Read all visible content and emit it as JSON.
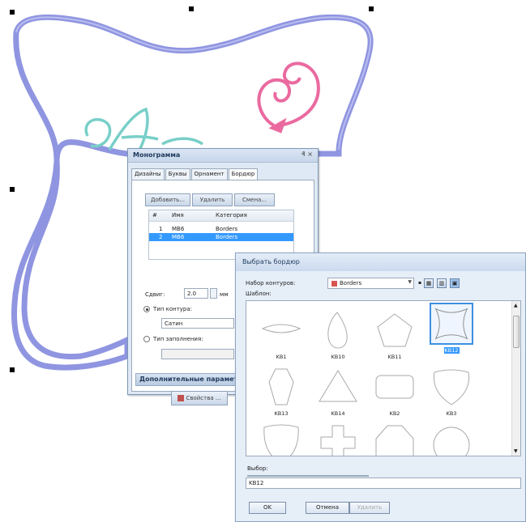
{
  "monogram_panel": {
    "title": "Монограмма",
    "title_controls": "₰ ×",
    "tabs": [
      "Дизайны",
      "Буквы",
      "Орнамент",
      "Бордюр"
    ],
    "buttons": {
      "add": "Добавить...",
      "remove": "Удалить",
      "change": "Смена..."
    },
    "table": {
      "headers": [
        "#",
        "Имя",
        "Категория"
      ],
      "rows": [
        {
          "num": "1",
          "name": "MB6",
          "category": "Borders"
        },
        {
          "num": "2",
          "name": "MB6",
          "category": "Borders"
        }
      ]
    },
    "offset_label": "Сдвиг:",
    "offset_value": "2.0",
    "offset_unit": "мм",
    "contour_type_label": "Тип контура:",
    "contour_type_value": "Сатин",
    "fill_type_label": "Тип заполнения:",
    "advanced_section": "Дополнительные параметры",
    "properties_button": "Свойства ..."
  },
  "border_dialog": {
    "title": "Выбрать бордюр",
    "contour_set_label": "Набор контуров:",
    "contour_set_value": "Borders",
    "template_label": "Шаблон:",
    "items": [
      "KB1",
      "KB10",
      "KB11",
      "KB12",
      "KB13",
      "KB14",
      "KB2",
      "KB3",
      "",
      "",
      "",
      ""
    ],
    "selected_item": "KB12",
    "selection_label": "Выбор:",
    "selection_value": "KB12",
    "ok": "OK",
    "cancel": "Отмена",
    "delete": "Удалить"
  },
  "colors": {
    "border_outline": "#8f95e0",
    "ornament_pink": "#ea6aa0",
    "letters_teal": "#78cfc8",
    "selection": "#3399ff"
  }
}
